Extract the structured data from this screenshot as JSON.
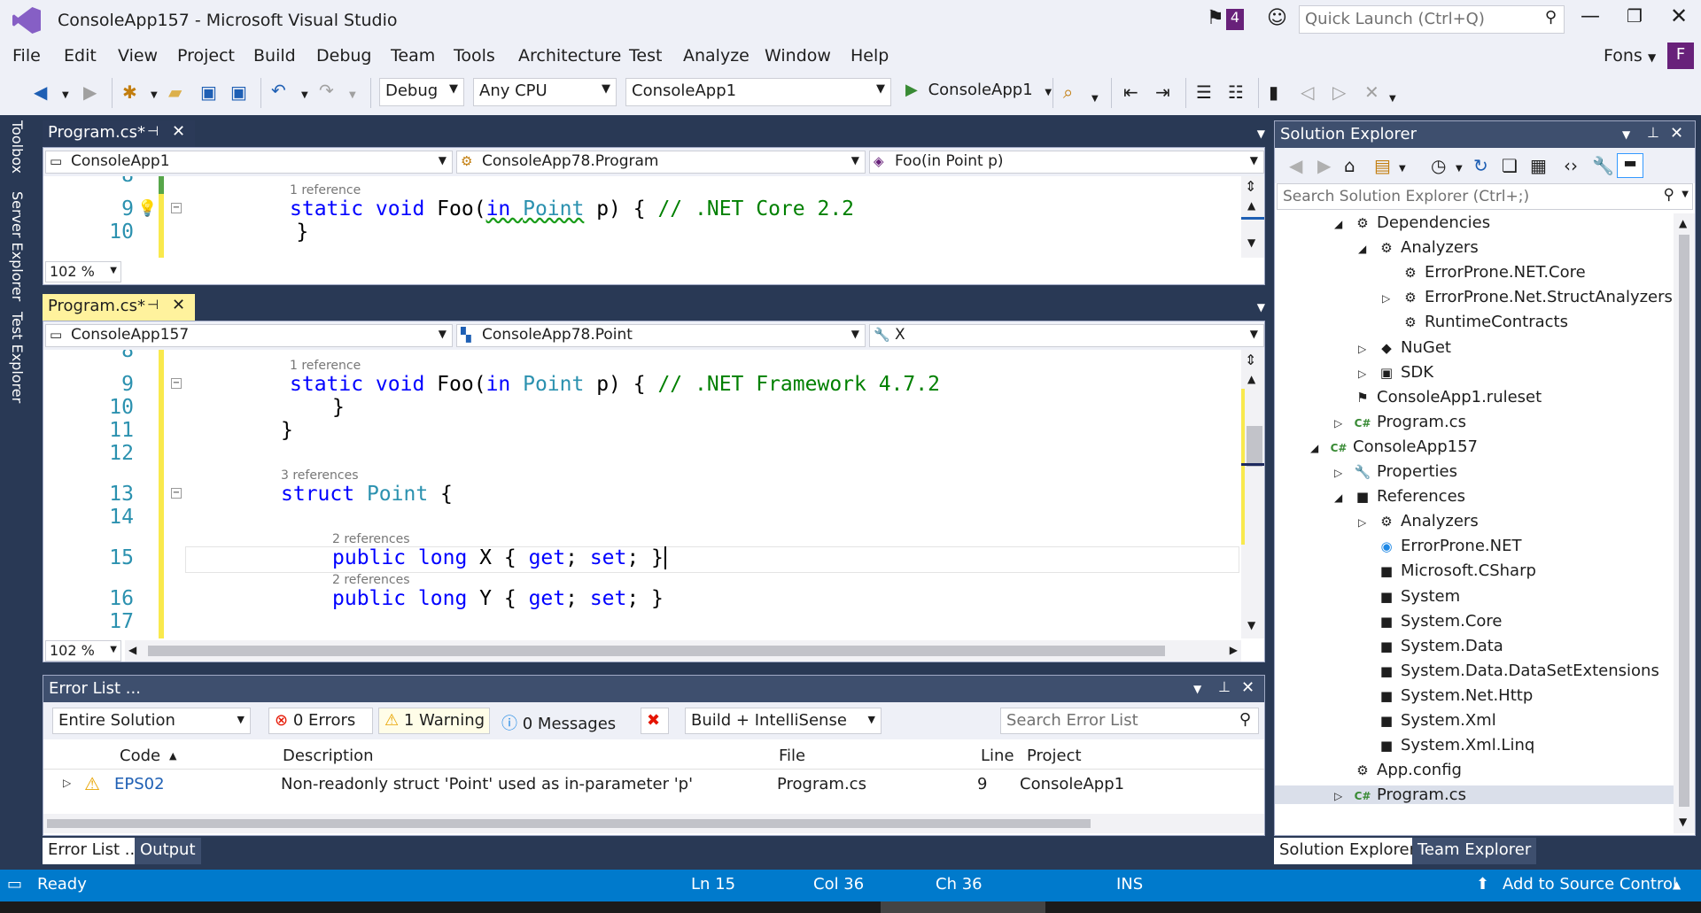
{
  "window": {
    "title": "ConsoleApp157 - Microsoft Visual Studio",
    "notification_count": "4",
    "quick_launch_placeholder": "Quick Launch (Ctrl+Q)",
    "user_name": "Fons",
    "user_initial": "F"
  },
  "menu": [
    "File",
    "Edit",
    "View",
    "Project",
    "Build",
    "Debug",
    "Team",
    "Tools",
    "Architecture",
    "Test",
    "Analyze",
    "Window",
    "Help"
  ],
  "toolbar": {
    "config": "Debug",
    "platform": "Any CPU",
    "startup_project": "ConsoleApp1",
    "run_label": "ConsoleApp1"
  },
  "left_tabs": [
    "Toolbox",
    "Server Explorer",
    "Test Explorer"
  ],
  "editor_top": {
    "tab": "Program.cs*",
    "nav_project": "ConsoleApp1",
    "nav_type": "ConsoleApp78.Program",
    "nav_member": "Foo(in Point p)",
    "zoom": "102 %",
    "lines": [
      {
        "num": "8",
        "code": ""
      },
      {
        "num": "9",
        "lens": "1 reference",
        "code_kw1": "static void ",
        "code_name": "Foo(",
        "code_kw2": "in ",
        "code_ty": "Point",
        "code_rest": " p) { ",
        "code_cm": "// .NET Core 2.2"
      },
      {
        "num": "10",
        "code": "    }"
      }
    ]
  },
  "editor_bottom": {
    "tab": "Program.cs*",
    "nav_project": "ConsoleApp157",
    "nav_type": "ConsoleApp78.Point",
    "nav_member": "X",
    "zoom": "102 %",
    "line8": "8",
    "line9": {
      "num": "9",
      "lens": "1 reference",
      "code_kw1": "static void ",
      "code_name": "Foo(",
      "code_kw2": "in ",
      "code_ty": "Point",
      "code_rest": " p) { ",
      "code_cm": "// .NET Framework 4.7.2"
    },
    "line10": {
      "num": "10",
      "code": "}"
    },
    "line11": {
      "num": "11",
      "code": "}"
    },
    "line12": {
      "num": "12"
    },
    "line13": {
      "num": "13",
      "lens": "3 references",
      "code_kw": "struct ",
      "code_ty": "Point",
      "code_rest": " {"
    },
    "line14": {
      "num": "14"
    },
    "line15": {
      "num": "15",
      "lens": "2 references",
      "code_kw": "public long ",
      "code_rest": "X { ",
      "code_kw2": "get",
      "code_rest2": "; ",
      "code_kw3": "set",
      "code_rest3": "; }"
    },
    "line16": {
      "num": "16",
      "lens": "2 references",
      "code_kw": "public long ",
      "code_rest": "Y { ",
      "code_kw2": "get",
      "code_rest2": "; ",
      "code_kw3": "set",
      "code_rest3": "; }"
    },
    "line17": {
      "num": "17"
    }
  },
  "error_list": {
    "title": "Error List ...",
    "scope": "Entire Solution",
    "errors": "0 Errors",
    "warnings": "1 Warning",
    "messages": "0 Messages",
    "build_filter": "Build + IntelliSense",
    "search_placeholder": "Search Error List",
    "columns": {
      "code": "Code",
      "description": "Description",
      "file": "File",
      "line": "Line",
      "project": "Project"
    },
    "rows": [
      {
        "code": "EPS02",
        "description": "Non-readonly struct 'Point' used as in-parameter 'p'",
        "file": "Program.cs",
        "line": "9",
        "project": "ConsoleApp1"
      }
    ],
    "bottom_tabs": [
      "Error List ...",
      "Output"
    ]
  },
  "solution_explorer": {
    "title": "Solution Explorer",
    "search_placeholder": "Search Solution Explorer (Ctrl+;)",
    "items": [
      {
        "label": "Dependencies",
        "indent": 1,
        "exp": "◢",
        "icon": "⚙"
      },
      {
        "label": "Analyzers",
        "indent": 2,
        "exp": "◢",
        "icon": "⚙"
      },
      {
        "label": "ErrorProne.NET.Core",
        "indent": 3,
        "exp": "",
        "icon": "⚙"
      },
      {
        "label": "ErrorProne.Net.StructAnalyzers",
        "indent": 3,
        "exp": "▷",
        "icon": "⚙"
      },
      {
        "label": "RuntimeContracts",
        "indent": 3,
        "exp": "",
        "icon": "⚙"
      },
      {
        "label": "NuGet",
        "indent": 2,
        "exp": "▷",
        "icon": "◆"
      },
      {
        "label": "SDK",
        "indent": 2,
        "exp": "▷",
        "icon": "▣"
      },
      {
        "label": "ConsoleApp1.ruleset",
        "indent": 1,
        "exp": "",
        "icon": "⚑"
      },
      {
        "label": "Program.cs",
        "indent": 1,
        "exp": "▷",
        "icon": "C#"
      },
      {
        "label": "ConsoleApp157",
        "indent": 0,
        "exp": "◢",
        "icon": "C#"
      },
      {
        "label": "Properties",
        "indent": 1,
        "exp": "▷",
        "icon": "🔧"
      },
      {
        "label": "References",
        "indent": 1,
        "exp": "◢",
        "icon": "■"
      },
      {
        "label": "Analyzers",
        "indent": 2,
        "exp": "▷",
        "icon": "⚙"
      },
      {
        "label": "ErrorProne.NET",
        "indent": 2,
        "exp": "",
        "icon": "◉"
      },
      {
        "label": "Microsoft.CSharp",
        "indent": 2,
        "exp": "",
        "icon": "■"
      },
      {
        "label": "System",
        "indent": 2,
        "exp": "",
        "icon": "■"
      },
      {
        "label": "System.Core",
        "indent": 2,
        "exp": "",
        "icon": "■"
      },
      {
        "label": "System.Data",
        "indent": 2,
        "exp": "",
        "icon": "■"
      },
      {
        "label": "System.Data.DataSetExtensions",
        "indent": 2,
        "exp": "",
        "icon": "■"
      },
      {
        "label": "System.Net.Http",
        "indent": 2,
        "exp": "",
        "icon": "■"
      },
      {
        "label": "System.Xml",
        "indent": 2,
        "exp": "",
        "icon": "■"
      },
      {
        "label": "System.Xml.Linq",
        "indent": 2,
        "exp": "",
        "icon": "■"
      },
      {
        "label": "App.config",
        "indent": 1,
        "exp": "",
        "icon": "⚙"
      },
      {
        "label": "Program.cs",
        "indent": 1,
        "exp": "▷",
        "icon": "C#"
      }
    ],
    "bottom_tabs": [
      "Solution Explorer",
      "Team Explorer"
    ]
  },
  "status": {
    "ready": "Ready",
    "ln": "Ln 15",
    "col": "Col 36",
    "ch": "Ch 36",
    "ins": "INS",
    "source_control": "Add to Source Control"
  }
}
